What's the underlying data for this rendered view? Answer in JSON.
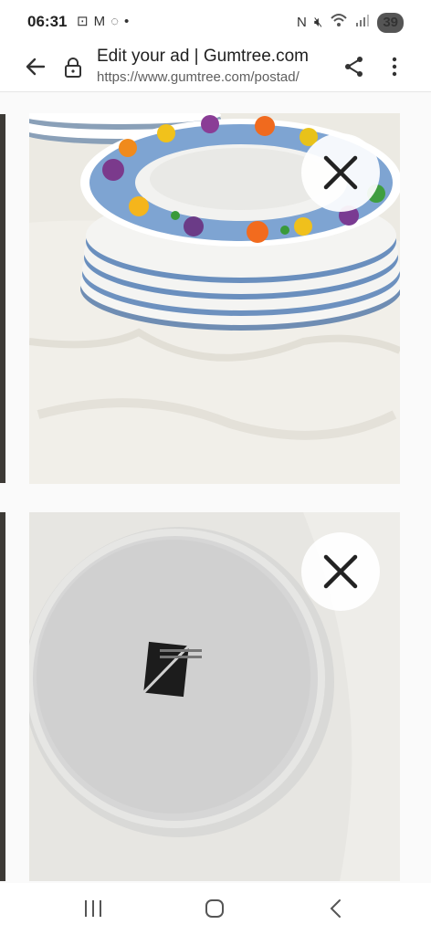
{
  "status_bar": {
    "time": "06:31",
    "notification_icons": [
      "screenshot-icon",
      "gmail-icon",
      "whatsapp-icon",
      "dot-icon"
    ],
    "system_icons": [
      "nfc-icon",
      "mute-icon",
      "wifi-icon",
      "signal-icon"
    ],
    "battery": "39"
  },
  "browser": {
    "title": "Edit your ad | Gumtree.com",
    "url": "https://www.gumtree.com/postad/"
  },
  "photos": [
    {
      "subject": "stacked-plates-photo",
      "remove_icon": "close-icon"
    },
    {
      "subject": "plate-underside-photo",
      "remove_icon": "close-icon"
    }
  ],
  "navbar": {
    "buttons": [
      "recent-apps-icon",
      "home-icon",
      "back-icon"
    ]
  }
}
